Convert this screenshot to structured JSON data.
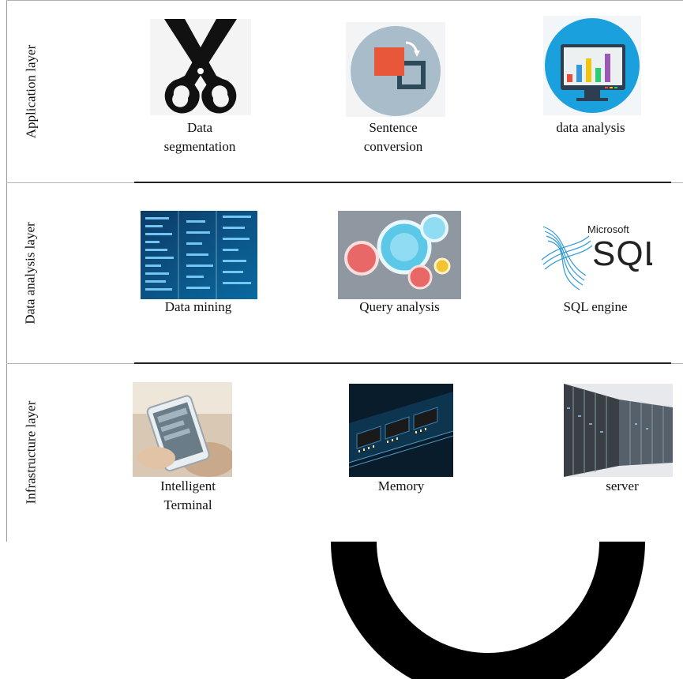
{
  "layers": [
    {
      "title": "Application layer",
      "items": [
        {
          "label_line1": "Data",
          "label_line2": "segmentation",
          "icon": "scissors-icon"
        },
        {
          "label_line1": "Sentence",
          "label_line2": "conversion",
          "icon": "transform-icon"
        },
        {
          "label_line1": "data analysis",
          "label_line2": "",
          "icon": "monitor-bar-chart-icon"
        }
      ]
    },
    {
      "title": "Data analysis layer",
      "items": [
        {
          "label_line1": "Data mining",
          "label_line2": "",
          "icon": "data-mining-image"
        },
        {
          "label_line1": "Query analysis",
          "label_line2": "",
          "icon": "query-bubbles-image"
        },
        {
          "label_line1": "SQL engine",
          "label_line2": "",
          "icon": "microsoft-sql-logo",
          "logo_text_top": "Microsoft",
          "logo_text_main": "SQL"
        }
      ]
    },
    {
      "title": "Infrastructure layer",
      "items": [
        {
          "label_line1": "Intelligent",
          "label_line2": "Terminal",
          "icon": "tablet-hand-image"
        },
        {
          "label_line1": "Memory",
          "label_line2": "",
          "icon": "memory-chip-image"
        },
        {
          "label_line1": "server",
          "label_line2": "",
          "icon": "server-room-image"
        }
      ]
    }
  ],
  "colors": {
    "scissors": "#111111",
    "circle_bg": "#a9bcc9",
    "orange_square": "#e8573a",
    "monitor_blue": "#1aa0dd",
    "sql_blue": "#1a8fd0",
    "watermark": "#000000"
  }
}
